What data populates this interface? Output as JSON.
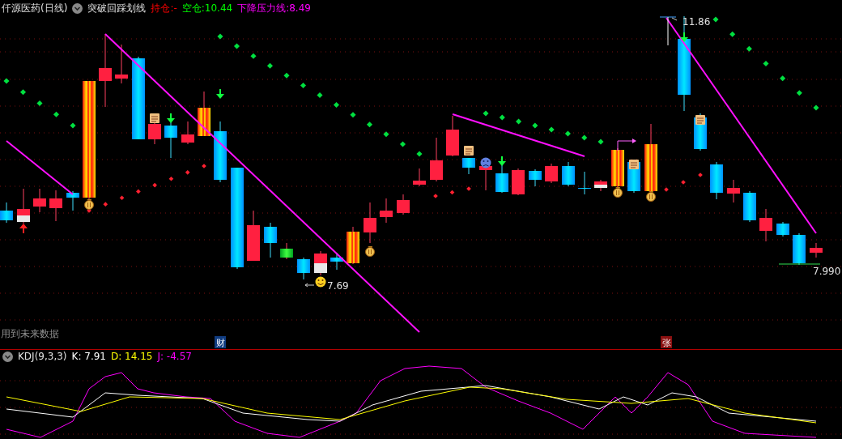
{
  "header": {
    "stock": "仟源医药(日线)",
    "indicator": "突破回踩划线",
    "items": [
      {
        "label": "持仓:",
        "value": "-",
        "color": "#ff0000"
      },
      {
        "label": "空仓:",
        "value": "10.44",
        "color": "#00ff00"
      },
      {
        "label": "下降压力线:",
        "value": "8.49",
        "color": "#ff00ff"
      }
    ]
  },
  "price_labels": {
    "high": "11.86",
    "low": "7.69",
    "last": "7.990"
  },
  "note": "用到未来数据",
  "markers": [
    {
      "text": "财"
    },
    {
      "text": "张"
    }
  ],
  "kdj": {
    "name": "KDJ(9,3,3)",
    "values": [
      {
        "label": "K:",
        "value": "7.91",
        "color": "#ffffff"
      },
      {
        "label": "D:",
        "value": "14.15",
        "color": "#ffff00"
      },
      {
        "label": "J:",
        "value": "-4.57",
        "color": "#ff00ff"
      }
    ]
  }
}
